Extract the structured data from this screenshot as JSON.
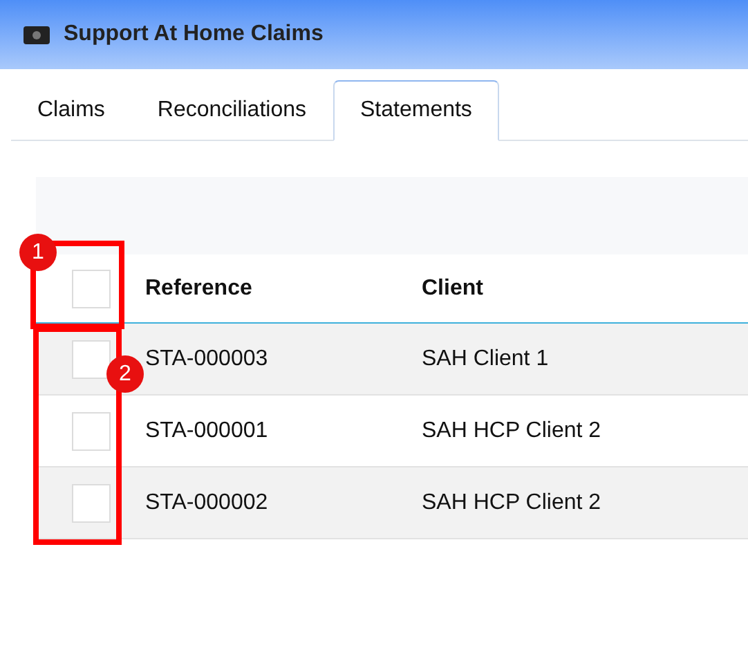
{
  "window": {
    "title": "Support At Home Claims"
  },
  "tabs": [
    {
      "label": "Claims",
      "selected": false
    },
    {
      "label": "Reconciliations",
      "selected": false
    },
    {
      "label": "Statements",
      "selected": true
    }
  ],
  "table": {
    "select_all": {
      "checked": false
    },
    "columns": [
      "Reference",
      "Client"
    ],
    "rows": [
      {
        "checked": false,
        "cells": [
          "STA-000003",
          "SAH Client 1"
        ]
      },
      {
        "checked": false,
        "cells": [
          "STA-000001",
          "SAH HCP Client 2"
        ]
      },
      {
        "checked": false,
        "cells": [
          "STA-000002",
          "SAH HCP Client 2"
        ]
      }
    ]
  },
  "annotations": [
    {
      "label": "1"
    },
    {
      "label": "2"
    }
  ]
}
